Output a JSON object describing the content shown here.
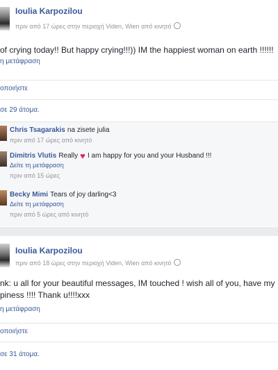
{
  "post1": {
    "author": "Ioulia Karpozilou",
    "meta": "πριν από 17 ώρες στην περιοχή Viden, Wien από κινητό",
    "text": "of crying today!! But happy crying!!!)) IM the happiest woman on earth !!!!!!",
    "see_translation": "η μετάφραση",
    "action": "οποιήστε",
    "likes": "σε 29 άτομα.",
    "comments": [
      {
        "name": "Chris Tsagarakis",
        "text": "na zisete julia",
        "time": "πριν από 17 ώρες από κινητό"
      },
      {
        "name": "Dimitris Vlutis",
        "text_before": "Really",
        "text_after": "I am happy for you and your Husband !!!",
        "translate": "Δείτε τη μετάφραση",
        "time": "πριν από 15 ώρες"
      },
      {
        "name": "Becky Mimi",
        "text": "Tears of joy darling<3",
        "translate": "Δείτε τη μετάφραση",
        "time": "πριν από 5 ώρες από κινητό"
      }
    ]
  },
  "post2": {
    "author": "Ioulia Karpozilou",
    "meta": "πριν από 18 ώρες στην περιοχή Viden, Wien από κινητό",
    "text_line1": "nk: u all for your beautiful messages, IM touched ! wish all of you, have my",
    "text_line2": "piness !!!! Thank u!!!!xxx",
    "see_translation": "η μετάφραση",
    "action": "οποιήστε",
    "likes": "σε 31 άτομα."
  },
  "icons": {
    "avatar": "profile-photo",
    "globe": "globe-icon",
    "heart": "heart-icon"
  }
}
